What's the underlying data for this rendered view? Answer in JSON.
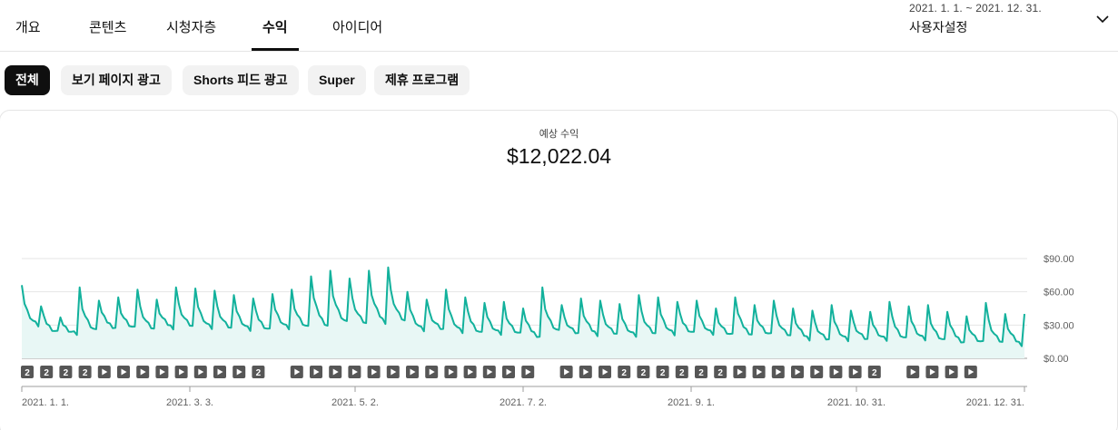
{
  "tabs": [
    {
      "label": "개요",
      "active": false
    },
    {
      "label": "콘텐츠",
      "active": false
    },
    {
      "label": "시청자층",
      "active": false
    },
    {
      "label": "수익",
      "active": true
    },
    {
      "label": "아이디어",
      "active": false
    }
  ],
  "date_picker": {
    "range": "2021. 1. 1. ~ 2021. 12. 31.",
    "preset": "사용자설정",
    "icon": "chevron-down-icon"
  },
  "filters": [
    {
      "label": "전체",
      "active": true
    },
    {
      "label": "보기 페이지 광고",
      "active": false
    },
    {
      "label": "Shorts 피드 광고",
      "active": false
    },
    {
      "label": "Super",
      "active": false
    },
    {
      "label": "제휴 프로그램",
      "active": false
    }
  ],
  "metric": {
    "label": "예상 수익",
    "value": "$12,022.04"
  },
  "colors": {
    "line": "#12b19c",
    "area": "#e8f7f5",
    "marker": "#565656"
  },
  "chart_data": {
    "type": "area",
    "y_ticks": [
      "$90.00",
      "$60.00",
      "$30.00",
      "$0.00"
    ],
    "ylim": [
      0,
      90
    ],
    "grid": true,
    "x_ticks": [
      "2021. 1. 1.",
      "2021. 3. 3.",
      "2021. 5. 2.",
      "2021. 7. 2.",
      "2021. 9. 1.",
      "2021. 10. 31.",
      "2021. 12. 31."
    ],
    "x_range": [
      "2021-01-01",
      "2021-12-31"
    ],
    "weekly_peaks": [
      66,
      47,
      37,
      64,
      52,
      55,
      62,
      53,
      64,
      63,
      61,
      57,
      54,
      58,
      62,
      74,
      79,
      72,
      79,
      82,
      60,
      53,
      62,
      55,
      50,
      51,
      45,
      64,
      48,
      54,
      52,
      49,
      57,
      55,
      51,
      52,
      45,
      55,
      48,
      52,
      45,
      43,
      48,
      43,
      42,
      51,
      47,
      48,
      42,
      38,
      50,
      40
    ],
    "weekly_troughs": [
      30,
      24,
      22,
      25,
      28,
      27,
      27,
      28,
      29,
      28,
      27,
      26,
      26,
      27,
      28,
      30,
      32,
      32,
      33,
      34,
      26,
      26,
      24,
      23,
      22,
      22,
      20,
      24,
      23,
      22,
      22,
      21,
      22,
      22,
      23,
      22,
      21,
      22,
      21,
      21,
      18,
      17,
      17,
      17,
      17,
      18,
      17,
      16,
      15,
      14,
      15,
      13
    ],
    "markers": [
      "2",
      "2",
      "2",
      "2",
      "play",
      "play",
      "play",
      "play",
      "play",
      "play",
      "play",
      "play",
      "2",
      "",
      "play",
      "play",
      "play",
      "play",
      "play",
      "play",
      "play",
      "play",
      "play",
      "play",
      "play",
      "play",
      "play",
      "",
      "play",
      "play",
      "play",
      "2",
      "2",
      "2",
      "2",
      "2",
      "2",
      "play",
      "play",
      "play",
      "play",
      "play",
      "play",
      "play",
      "2",
      "",
      "play",
      "play",
      "play",
      "play"
    ]
  }
}
